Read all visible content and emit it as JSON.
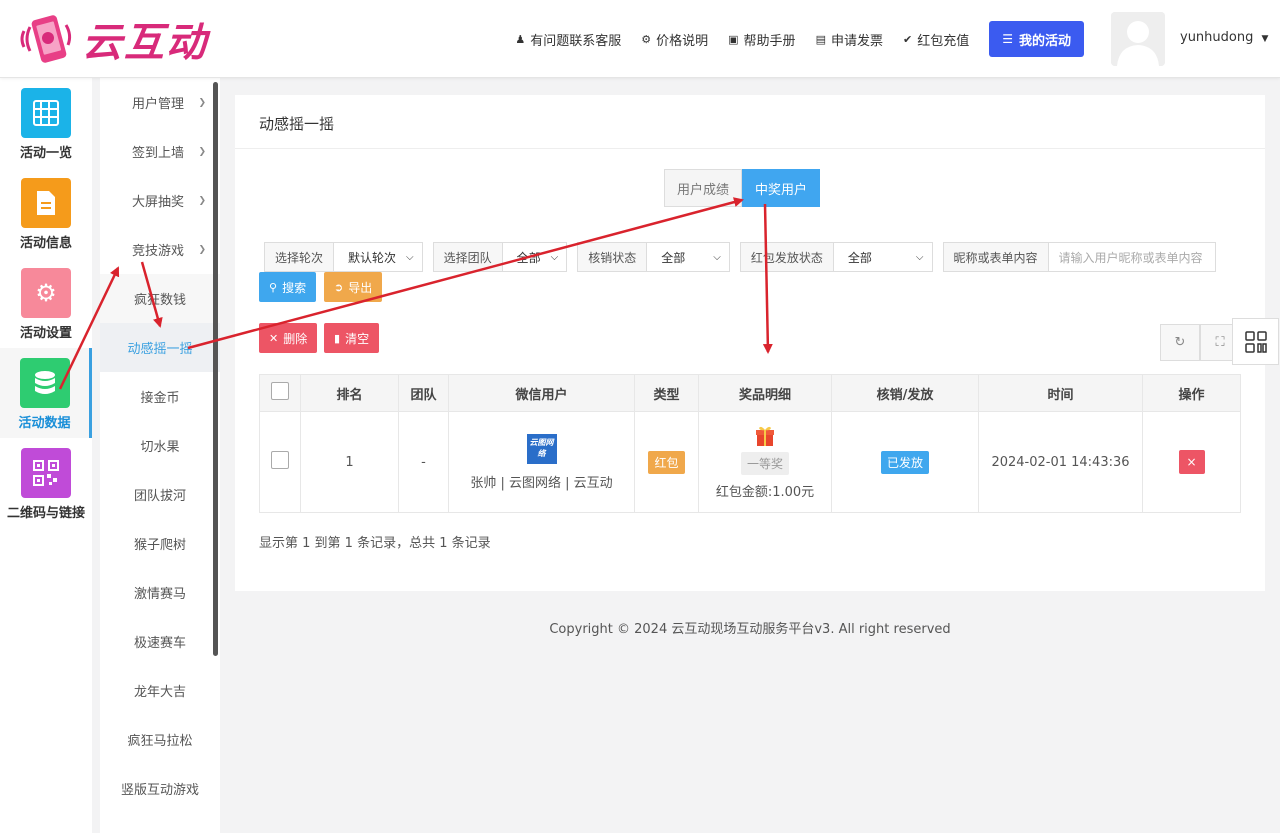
{
  "header": {
    "logo_text": "云互动",
    "nav": [
      {
        "icon": "person-plus-icon",
        "label": "有问题联系客服"
      },
      {
        "icon": "gear-icon",
        "label": "价格说明"
      },
      {
        "icon": "book-icon",
        "label": "帮助手册"
      },
      {
        "icon": "printer-icon",
        "label": "申请发票"
      },
      {
        "icon": "shield-check-icon",
        "label": "红包充值"
      }
    ],
    "my_activity": "我的活动",
    "username": "yunhudong"
  },
  "rail": [
    {
      "label": "活动一览",
      "icon": "grid-icon",
      "color": "#1bb3e8"
    },
    {
      "label": "活动信息",
      "icon": "document-icon",
      "color": "#f59b1b"
    },
    {
      "label": "活动设置",
      "icon": "gear-icon",
      "color": "#f7899a"
    },
    {
      "label": "活动数据",
      "icon": "database-icon",
      "color": "#2ecc71",
      "active": true
    },
    {
      "label": "二维码与链接",
      "icon": "qrcode-icon",
      "color": "#c04bd8"
    }
  ],
  "submenu": {
    "parents": [
      "用户管理",
      "签到上墙",
      "大屏抽奖",
      "竞技游戏"
    ],
    "children": [
      "疯狂数钱",
      "动感摇一摇",
      "接金币",
      "切水果",
      "团队拔河",
      "猴子爬树",
      "激情赛马",
      "极速赛车",
      "龙年大吉",
      "疯狂马拉松",
      "竖版互动游戏"
    ]
  },
  "panel": {
    "title": "动感摇一摇",
    "tabs": [
      "用户成绩",
      "中奖用户"
    ],
    "filters": [
      {
        "label": "选择轮次",
        "value": "默认轮次"
      },
      {
        "label": "选择团队",
        "value": "全部"
      },
      {
        "label": "核销状态",
        "value": "全部"
      },
      {
        "label": "红包发放状态",
        "value": "全部"
      }
    ],
    "search_label": "昵称或表单内容",
    "search_placeholder": "请输入用户昵称或表单内容",
    "buttons": {
      "search": "搜索",
      "export": "导出",
      "delete": "删除",
      "clear": "清空"
    },
    "table": {
      "headers": [
        "排名",
        "团队",
        "微信用户",
        "类型",
        "奖品明细",
        "核销/发放",
        "时间",
        "操作"
      ],
      "rows": [
        {
          "rank": "1",
          "team": "-",
          "user_logo": "云图网络",
          "user": "张帅 | 云图网络 | 云互动",
          "type": "红包",
          "prize_level": "一等奖",
          "prize_amount": "红包金额:1.00元",
          "status": "已发放",
          "time": "2024-02-01 14:43:36",
          "action": "×"
        }
      ]
    },
    "pager": "显示第 1 到第 1 条记录，总共 1 条记录"
  },
  "footer": {
    "copyright": "Copyright © 2024 云互动现场互动服务平台v3. All right reserved"
  }
}
